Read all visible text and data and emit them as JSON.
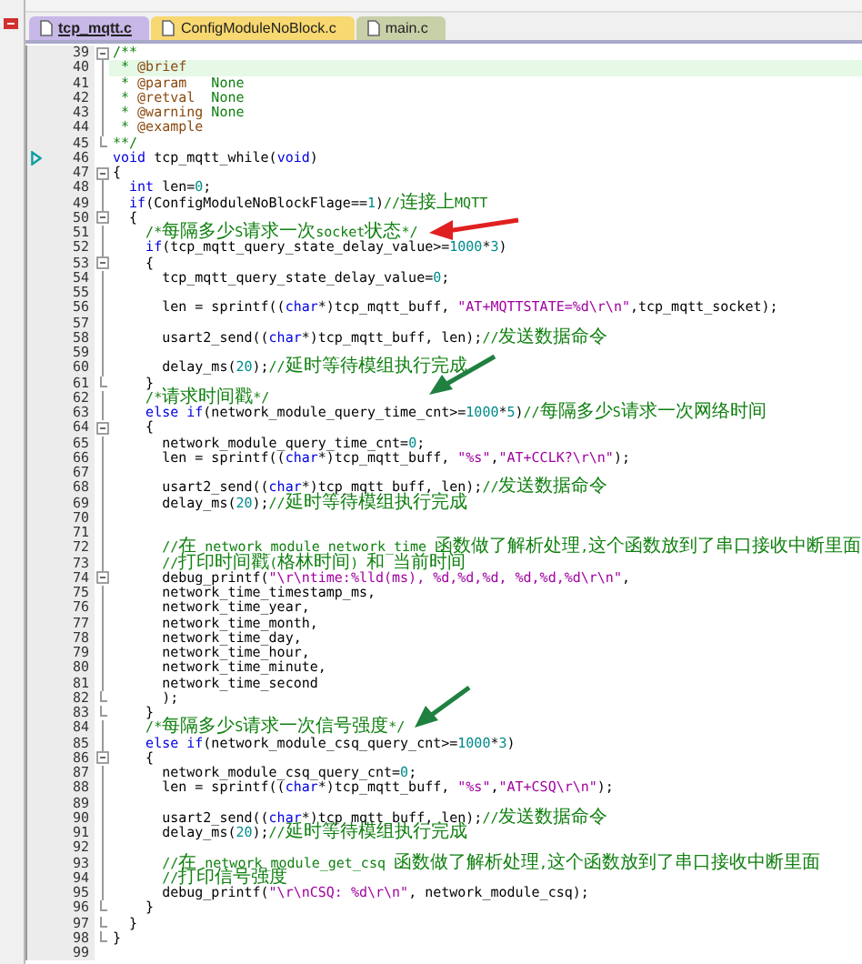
{
  "tabs": [
    {
      "label": "tcp_mqtt.c",
      "selected": true,
      "color": "#c8b8e8"
    },
    {
      "label": "ConfigModuleNoBlock.c",
      "selected": false,
      "color": "#f8d870"
    },
    {
      "label": "main.c",
      "selected": false,
      "color": "#c8d0a8"
    }
  ],
  "lines": [
    {
      "number": "39",
      "collapsible": true,
      "segments": [
        {
          "kind": "cm",
          "text": "/**"
        }
      ]
    },
    {
      "number": "40",
      "current": true,
      "segments": [
        {
          "kind": "cm",
          "text": " * "
        },
        {
          "kind": "doc",
          "text": "@brief"
        }
      ]
    },
    {
      "number": "41",
      "segments": [
        {
          "kind": "cm",
          "text": " * "
        },
        {
          "kind": "doc",
          "text": "@param"
        },
        {
          "kind": "cm",
          "text": "   None"
        }
      ]
    },
    {
      "number": "42",
      "segments": [
        {
          "kind": "cm",
          "text": " * "
        },
        {
          "kind": "doc",
          "text": "@retval"
        },
        {
          "kind": "cm",
          "text": "  None"
        }
      ]
    },
    {
      "number": "43",
      "segments": [
        {
          "kind": "cm",
          "text": " * "
        },
        {
          "kind": "doc",
          "text": "@warning"
        },
        {
          "kind": "cm",
          "text": " None"
        }
      ]
    },
    {
      "number": "44",
      "segments": [
        {
          "kind": "cm",
          "text": " * "
        },
        {
          "kind": "doc",
          "text": "@example"
        }
      ]
    },
    {
      "number": "45",
      "block_end": true,
      "segments": [
        {
          "kind": "cm",
          "text": "**/"
        }
      ]
    },
    {
      "number": "46",
      "marker": true,
      "segments": [
        {
          "kind": "kw",
          "text": "void"
        },
        {
          "kind": "plain",
          "text": " tcp_mqtt_while("
        },
        {
          "kind": "kw",
          "text": "void"
        },
        {
          "kind": "plain",
          "text": ")"
        }
      ]
    },
    {
      "number": "47",
      "collapsible": true,
      "segments": [
        {
          "kind": "plain",
          "text": "{"
        }
      ]
    },
    {
      "number": "48",
      "segments": [
        {
          "kind": "kw",
          "text": "  int"
        },
        {
          "kind": "plain",
          "text": " len="
        },
        {
          "kind": "num",
          "text": "0"
        },
        {
          "kind": "plain",
          "text": ";"
        }
      ]
    },
    {
      "number": "49",
      "segments": [
        {
          "kind": "kw",
          "text": "  if"
        },
        {
          "kind": "plain",
          "text": "(ConfigModuleNoBlockFlage=="
        },
        {
          "kind": "num",
          "text": "1"
        },
        {
          "kind": "plain",
          "text": ")"
        },
        {
          "kind": "cm",
          "text": "//连接上MQTT"
        }
      ]
    },
    {
      "number": "50",
      "collapsible": true,
      "segments": [
        {
          "kind": "plain",
          "text": "  {"
        }
      ]
    },
    {
      "number": "51",
      "segments": [
        {
          "kind": "cm",
          "text": "    /*每隔多少S请求一次socket状态*/"
        }
      ]
    },
    {
      "number": "52",
      "segments": [
        {
          "kind": "kw",
          "text": "    if"
        },
        {
          "kind": "plain",
          "text": "(tcp_mqtt_query_state_delay_value>="
        },
        {
          "kind": "num",
          "text": "1000"
        },
        {
          "kind": "plain",
          "text": "*"
        },
        {
          "kind": "num",
          "text": "3"
        },
        {
          "kind": "plain",
          "text": ")"
        }
      ]
    },
    {
      "number": "53",
      "collapsible": true,
      "segments": [
        {
          "kind": "plain",
          "text": "    {"
        }
      ]
    },
    {
      "number": "54",
      "segments": [
        {
          "kind": "plain",
          "text": "      tcp_mqtt_query_state_delay_value="
        },
        {
          "kind": "num",
          "text": "0"
        },
        {
          "kind": "plain",
          "text": ";"
        }
      ]
    },
    {
      "number": "55"
    },
    {
      "number": "56",
      "segments": [
        {
          "kind": "plain",
          "text": "      len = sprintf(("
        },
        {
          "kind": "kw",
          "text": "char"
        },
        {
          "kind": "plain",
          "text": "*)tcp_mqtt_buff, "
        },
        {
          "kind": "str",
          "text": "\"AT+MQTTSTATE=%d\\r\\n\""
        },
        {
          "kind": "plain",
          "text": ",tcp_mqtt_socket);"
        }
      ]
    },
    {
      "number": "57"
    },
    {
      "number": "58",
      "segments": [
        {
          "kind": "plain",
          "text": "      usart2_send(("
        },
        {
          "kind": "kw",
          "text": "char"
        },
        {
          "kind": "plain",
          "text": "*)tcp_mqtt_buff, len);"
        },
        {
          "kind": "cm",
          "text": "//发送数据命令"
        }
      ]
    },
    {
      "number": "59"
    },
    {
      "number": "60",
      "segments": [
        {
          "kind": "plain",
          "text": "      delay_ms("
        },
        {
          "kind": "num",
          "text": "20"
        },
        {
          "kind": "plain",
          "text": ");"
        },
        {
          "kind": "cm",
          "text": "//延时等待模组执行完成"
        }
      ]
    },
    {
      "number": "61",
      "block_end": true,
      "segments": [
        {
          "kind": "plain",
          "text": "    }"
        }
      ]
    },
    {
      "number": "62",
      "segments": [
        {
          "kind": "cm",
          "text": "    /*请求时间戳*/"
        }
      ]
    },
    {
      "number": "63",
      "segments": [
        {
          "kind": "kw",
          "text": "    else if"
        },
        {
          "kind": "plain",
          "text": "(network_module_query_time_cnt>="
        },
        {
          "kind": "num",
          "text": "1000"
        },
        {
          "kind": "plain",
          "text": "*"
        },
        {
          "kind": "num",
          "text": "5"
        },
        {
          "kind": "plain",
          "text": ")"
        },
        {
          "kind": "cm",
          "text": "//每隔多少S请求一次网络时间"
        }
      ]
    },
    {
      "number": "64",
      "collapsible": true,
      "segments": [
        {
          "kind": "plain",
          "text": "    {"
        }
      ]
    },
    {
      "number": "65",
      "segments": [
        {
          "kind": "plain",
          "text": "      network_module_query_time_cnt="
        },
        {
          "kind": "num",
          "text": "0"
        },
        {
          "kind": "plain",
          "text": ";"
        }
      ]
    },
    {
      "number": "66",
      "segments": [
        {
          "kind": "plain",
          "text": "      len = sprintf(("
        },
        {
          "kind": "kw",
          "text": "char"
        },
        {
          "kind": "plain",
          "text": "*)tcp_mqtt_buff, "
        },
        {
          "kind": "str",
          "text": "\"%s\""
        },
        {
          "kind": "plain",
          "text": ","
        },
        {
          "kind": "str",
          "text": "\"AT+CCLK?\\r\\n\""
        },
        {
          "kind": "plain",
          "text": ");"
        }
      ]
    },
    {
      "number": "67"
    },
    {
      "number": "68",
      "segments": [
        {
          "kind": "plain",
          "text": "      usart2_send(("
        },
        {
          "kind": "kw",
          "text": "char"
        },
        {
          "kind": "plain",
          "text": "*)tcp_mqtt_buff, len);"
        },
        {
          "kind": "cm",
          "text": "//发送数据命令"
        }
      ]
    },
    {
      "number": "69",
      "segments": [
        {
          "kind": "plain",
          "text": "      delay_ms("
        },
        {
          "kind": "num",
          "text": "20"
        },
        {
          "kind": "plain",
          "text": ");"
        },
        {
          "kind": "cm",
          "text": "//延时等待模组执行完成"
        }
      ]
    },
    {
      "number": "70"
    },
    {
      "number": "71"
    },
    {
      "number": "72",
      "segments": [
        {
          "kind": "cm",
          "text": "      //在 network_module_network_time 函数做了解析处理,这个函数放到了串口接收中断里面"
        }
      ]
    },
    {
      "number": "73",
      "segments": [
        {
          "kind": "cm",
          "text": "      //打印时间戳(格林时间) 和 当前时间"
        }
      ]
    },
    {
      "number": "74",
      "collapsible": true,
      "segments": [
        {
          "kind": "plain",
          "text": "      debug_printf("
        },
        {
          "kind": "str",
          "text": "\"\\r\\ntime:%lld(ms), %d,%d,%d, %d,%d,%d\\r\\n\""
        },
        {
          "kind": "plain",
          "text": ","
        }
      ]
    },
    {
      "number": "75",
      "segments": [
        {
          "kind": "plain",
          "text": "      network_time_timestamp_ms,"
        }
      ]
    },
    {
      "number": "76",
      "segments": [
        {
          "kind": "plain",
          "text": "      network_time_year,"
        }
      ]
    },
    {
      "number": "77",
      "segments": [
        {
          "kind": "plain",
          "text": "      network_time_month,"
        }
      ]
    },
    {
      "number": "78",
      "segments": [
        {
          "kind": "plain",
          "text": "      network_time_day,"
        }
      ]
    },
    {
      "number": "79",
      "segments": [
        {
          "kind": "plain",
          "text": "      network_time_hour,"
        }
      ]
    },
    {
      "number": "80",
      "segments": [
        {
          "kind": "plain",
          "text": "      network_time_minute,"
        }
      ]
    },
    {
      "number": "81",
      "segments": [
        {
          "kind": "plain",
          "text": "      network_time_second"
        }
      ]
    },
    {
      "number": "82",
      "block_end": true,
      "segments": [
        {
          "kind": "plain",
          "text": "      );"
        }
      ]
    },
    {
      "number": "83",
      "block_end": true,
      "segments": [
        {
          "kind": "plain",
          "text": "    }"
        }
      ]
    },
    {
      "number": "84",
      "segments": [
        {
          "kind": "cm",
          "text": "    /*每隔多少S请求一次信号强度*/"
        }
      ]
    },
    {
      "number": "85",
      "segments": [
        {
          "kind": "kw",
          "text": "    else if"
        },
        {
          "kind": "plain",
          "text": "(network_module_csq_query_cnt>="
        },
        {
          "kind": "num",
          "text": "1000"
        },
        {
          "kind": "plain",
          "text": "*"
        },
        {
          "kind": "num",
          "text": "3"
        },
        {
          "kind": "plain",
          "text": ")"
        }
      ]
    },
    {
      "number": "86",
      "collapsible": true,
      "segments": [
        {
          "kind": "plain",
          "text": "    {"
        }
      ]
    },
    {
      "number": "87",
      "segments": [
        {
          "kind": "plain",
          "text": "      network_module_csq_query_cnt="
        },
        {
          "kind": "num",
          "text": "0"
        },
        {
          "kind": "plain",
          "text": ";"
        }
      ]
    },
    {
      "number": "88",
      "segments": [
        {
          "kind": "plain",
          "text": "      len = sprintf(("
        },
        {
          "kind": "kw",
          "text": "char"
        },
        {
          "kind": "plain",
          "text": "*)tcp_mqtt_buff, "
        },
        {
          "kind": "str",
          "text": "\"%s\""
        },
        {
          "kind": "plain",
          "text": ","
        },
        {
          "kind": "str",
          "text": "\"AT+CSQ\\r\\n\""
        },
        {
          "kind": "plain",
          "text": ");"
        }
      ]
    },
    {
      "number": "89"
    },
    {
      "number": "90",
      "segments": [
        {
          "kind": "plain",
          "text": "      usart2_send(("
        },
        {
          "kind": "kw",
          "text": "char"
        },
        {
          "kind": "plain",
          "text": "*)tcp_mqtt_buff, len);"
        },
        {
          "kind": "cm",
          "text": "//发送数据命令"
        }
      ]
    },
    {
      "number": "91",
      "segments": [
        {
          "kind": "plain",
          "text": "      delay_ms("
        },
        {
          "kind": "num",
          "text": "20"
        },
        {
          "kind": "plain",
          "text": ");"
        },
        {
          "kind": "cm",
          "text": "//延时等待模组执行完成"
        }
      ]
    },
    {
      "number": "92"
    },
    {
      "number": "93",
      "segments": [
        {
          "kind": "cm",
          "text": "      //在 network_module_get_csq 函数做了解析处理,这个函数放到了串口接收中断里面"
        }
      ]
    },
    {
      "number": "94",
      "segments": [
        {
          "kind": "cm",
          "text": "      //打印信号强度"
        }
      ]
    },
    {
      "number": "95",
      "segments": [
        {
          "kind": "plain",
          "text": "      debug_printf("
        },
        {
          "kind": "str",
          "text": "\"\\r\\nCSQ: %d\\r\\n\""
        },
        {
          "kind": "plain",
          "text": ", network_module_csq);"
        }
      ]
    },
    {
      "number": "96",
      "block_end": true,
      "segments": [
        {
          "kind": "plain",
          "text": "    }"
        }
      ]
    },
    {
      "number": "97",
      "block_end": true,
      "segments": [
        {
          "kind": "plain",
          "text": "  }"
        }
      ]
    },
    {
      "number": "98",
      "block_end": true,
      "segments": [
        {
          "kind": "plain",
          "text": "}"
        }
      ]
    },
    {
      "number": "99"
    }
  ]
}
